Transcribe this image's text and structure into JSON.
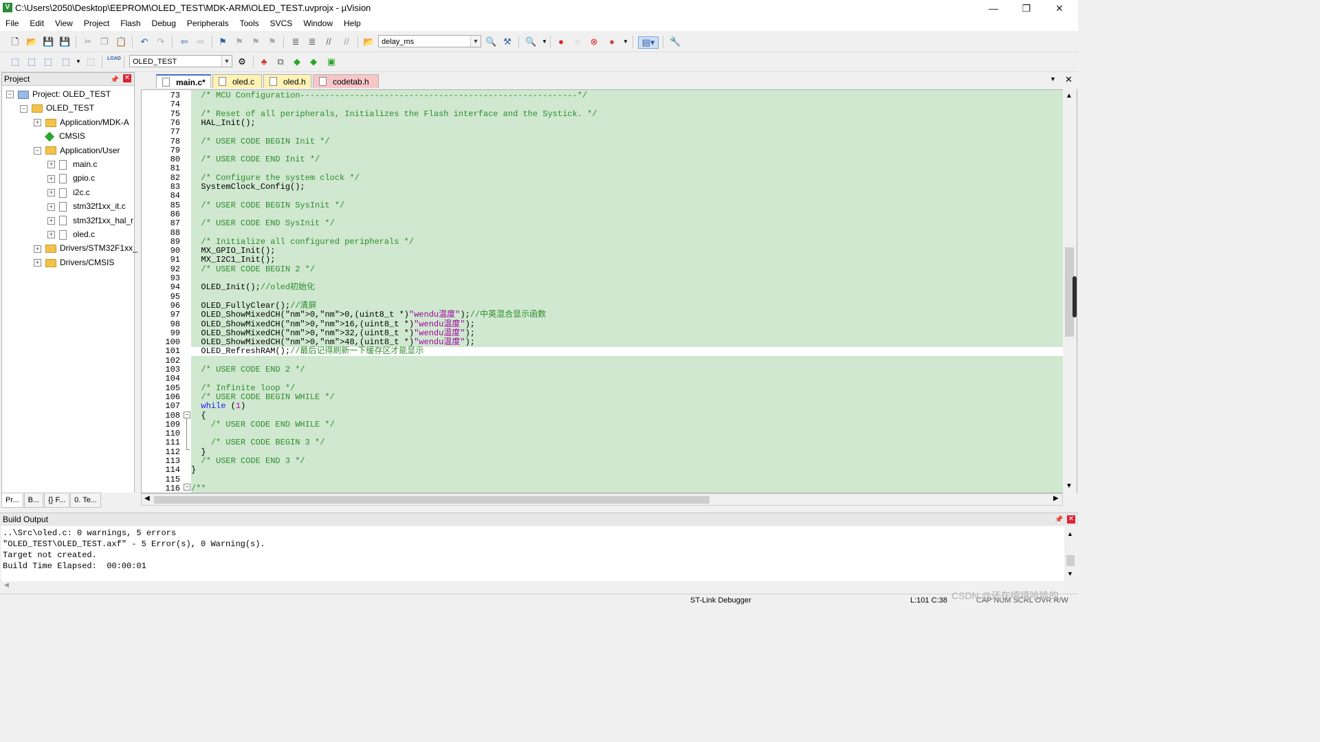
{
  "window": {
    "title": "C:\\Users\\2050\\Desktop\\EEPROM\\OLED_TEST\\MDK-ARM\\OLED_TEST.uvprojx - µVision",
    "app_icon": "uvision-icon",
    "minimize": "—",
    "maximize": "❐",
    "close": "✕"
  },
  "menu": [
    "File",
    "Edit",
    "View",
    "Project",
    "Flash",
    "Debug",
    "Peripherals",
    "Tools",
    "SVCS",
    "Window",
    "Help"
  ],
  "toolbar1": {
    "function_combo": "delay_ms"
  },
  "toolbar2": {
    "target_combo": "OLED_TEST",
    "load_label": "LOAD"
  },
  "project_panel": {
    "title": "Project",
    "tree": [
      {
        "label": "Project: OLED_TEST",
        "level": 0,
        "kind": "project",
        "toggle": "-"
      },
      {
        "label": "OLED_TEST",
        "level": 1,
        "kind": "target",
        "toggle": "-"
      },
      {
        "label": "Application/MDK-A",
        "level": 2,
        "kind": "folder",
        "toggle": "+"
      },
      {
        "label": "CMSIS",
        "level": 2,
        "kind": "diamond",
        "toggle": ""
      },
      {
        "label": "Application/User",
        "level": 2,
        "kind": "folder",
        "toggle": "-"
      },
      {
        "label": "main.c",
        "level": 3,
        "kind": "file",
        "toggle": "+"
      },
      {
        "label": "gpio.c",
        "level": 3,
        "kind": "file",
        "toggle": "+"
      },
      {
        "label": "i2c.c",
        "level": 3,
        "kind": "file",
        "toggle": "+"
      },
      {
        "label": "stm32f1xx_it.c",
        "level": 3,
        "kind": "file",
        "toggle": "+"
      },
      {
        "label": "stm32f1xx_hal_r",
        "level": 3,
        "kind": "file",
        "toggle": "+"
      },
      {
        "label": "oled.c",
        "level": 3,
        "kind": "file",
        "toggle": "+"
      },
      {
        "label": "Drivers/STM32F1xx_",
        "level": 2,
        "kind": "folder",
        "toggle": "+"
      },
      {
        "label": "Drivers/CMSIS",
        "level": 2,
        "kind": "folder",
        "toggle": "+"
      }
    ],
    "bottom_tabs": [
      "Pr...",
      "B...",
      "{} F...",
      "0. Te..."
    ]
  },
  "editor_tabs": [
    {
      "label": "main.c*",
      "color": "#ffffff",
      "active": true
    },
    {
      "label": "oled.c",
      "color": "#fff2b3",
      "active": false
    },
    {
      "label": "oled.h",
      "color": "#fff2b3",
      "active": false
    },
    {
      "label": "codetab.h",
      "color": "#f7c7c7",
      "active": false
    }
  ],
  "code_lines": [
    {
      "n": "73",
      "t": "  /* MCU Configuration--------------------------------------------------------*/",
      "c": "cm"
    },
    {
      "n": "74",
      "t": "",
      "c": ""
    },
    {
      "n": "75",
      "t": "  /* Reset of all peripherals, Initializes the Flash interface and the Systick. */",
      "c": "cm"
    },
    {
      "n": "76",
      "t": "  HAL_Init();",
      "c": ""
    },
    {
      "n": "77",
      "t": "",
      "c": ""
    },
    {
      "n": "78",
      "t": "  /* USER CODE BEGIN Init */",
      "c": "cm"
    },
    {
      "n": "79",
      "t": "",
      "c": ""
    },
    {
      "n": "80",
      "t": "  /* USER CODE END Init */",
      "c": "cm"
    },
    {
      "n": "81",
      "t": "",
      "c": ""
    },
    {
      "n": "82",
      "t": "  /* Configure the system clock */",
      "c": "cm"
    },
    {
      "n": "83",
      "t": "  SystemClock_Config();",
      "c": ""
    },
    {
      "n": "84",
      "t": "",
      "c": ""
    },
    {
      "n": "85",
      "t": "  /* USER CODE BEGIN SysInit */",
      "c": "cm"
    },
    {
      "n": "86",
      "t": "",
      "c": ""
    },
    {
      "n": "87",
      "t": "  /* USER CODE END SysInit */",
      "c": "cm"
    },
    {
      "n": "88",
      "t": "",
      "c": ""
    },
    {
      "n": "89",
      "t": "  /* Initialize all configured peripherals */",
      "c": "cm"
    },
    {
      "n": "90",
      "t": "  MX_GPIO_Init();",
      "c": ""
    },
    {
      "n": "91",
      "t": "  MX_I2C1_Init();",
      "c": ""
    },
    {
      "n": "92",
      "t": "  /* USER CODE BEGIN 2 */",
      "c": "cm"
    },
    {
      "n": "93",
      "t": "",
      "c": ""
    },
    {
      "n": "94",
      "t": "  OLED_Init();//oled初始化",
      "c": "mixed"
    },
    {
      "n": "95",
      "t": "",
      "c": ""
    },
    {
      "n": "96",
      "t": "  OLED_FullyClear();//清屏",
      "c": "mixed"
    },
    {
      "n": "97",
      "t": "  OLED_ShowMixedCH(0,0,(uint8_t *)\"wendu温度\");//中英混合显示函数",
      "c": "mixed"
    },
    {
      "n": "98",
      "t": "  OLED_ShowMixedCH(0,16,(uint8_t *)\"wendu温度\");",
      "c": "mixed"
    },
    {
      "n": "99",
      "t": "  OLED_ShowMixedCH(0,32,(uint8_t *)\"wendu温度\");",
      "c": "mixed"
    },
    {
      "n": "100",
      "t": "  OLED_ShowMixedCH(0,48,(uint8_t *)\"wendu温度\");",
      "c": "mixed"
    },
    {
      "n": "101",
      "t": "  OLED_RefreshRAM();//最后记得刷新一下缓存区才能显示",
      "c": "mixed"
    },
    {
      "n": "102",
      "t": "",
      "c": ""
    },
    {
      "n": "103",
      "t": "  /* USER CODE END 2 */",
      "c": "cm"
    },
    {
      "n": "104",
      "t": "",
      "c": ""
    },
    {
      "n": "105",
      "t": "  /* Infinite loop */",
      "c": "cm"
    },
    {
      "n": "106",
      "t": "  /* USER CODE BEGIN WHILE */",
      "c": "cm"
    },
    {
      "n": "107",
      "t": "  while (1)",
      "c": "kw"
    },
    {
      "n": "108",
      "t": "  {",
      "c": ""
    },
    {
      "n": "109",
      "t": "    /* USER CODE END WHILE */",
      "c": "cm"
    },
    {
      "n": "110",
      "t": "",
      "c": ""
    },
    {
      "n": "111",
      "t": "    /* USER CODE BEGIN 3 */",
      "c": "cm"
    },
    {
      "n": "112",
      "t": "  }",
      "c": ""
    },
    {
      "n": "113",
      "t": "  /* USER CODE END 3 */",
      "c": "cm"
    },
    {
      "n": "114",
      "t": "}",
      "c": ""
    },
    {
      "n": "115",
      "t": "",
      "c": ""
    },
    {
      "n": "116",
      "t": "/**",
      "c": "cm"
    }
  ],
  "current_line": "101",
  "build_output": {
    "title": "Build Output",
    "lines": [
      "..\\Src\\oled.c: 0 warnings, 5 errors",
      "\"OLED_TEST\\OLED_TEST.axf\" - 5 Error(s), 0 Warning(s).",
      "Target not created.",
      "Build Time Elapsed:  00:00:01"
    ]
  },
  "status": {
    "debugger": "ST-Link Debugger",
    "position": "L:101 C:38",
    "indicators": "CAP  NUM  SCRL  OVR  R/W"
  },
  "watermark": "CSDN @还在嘻嘻哈哈的"
}
